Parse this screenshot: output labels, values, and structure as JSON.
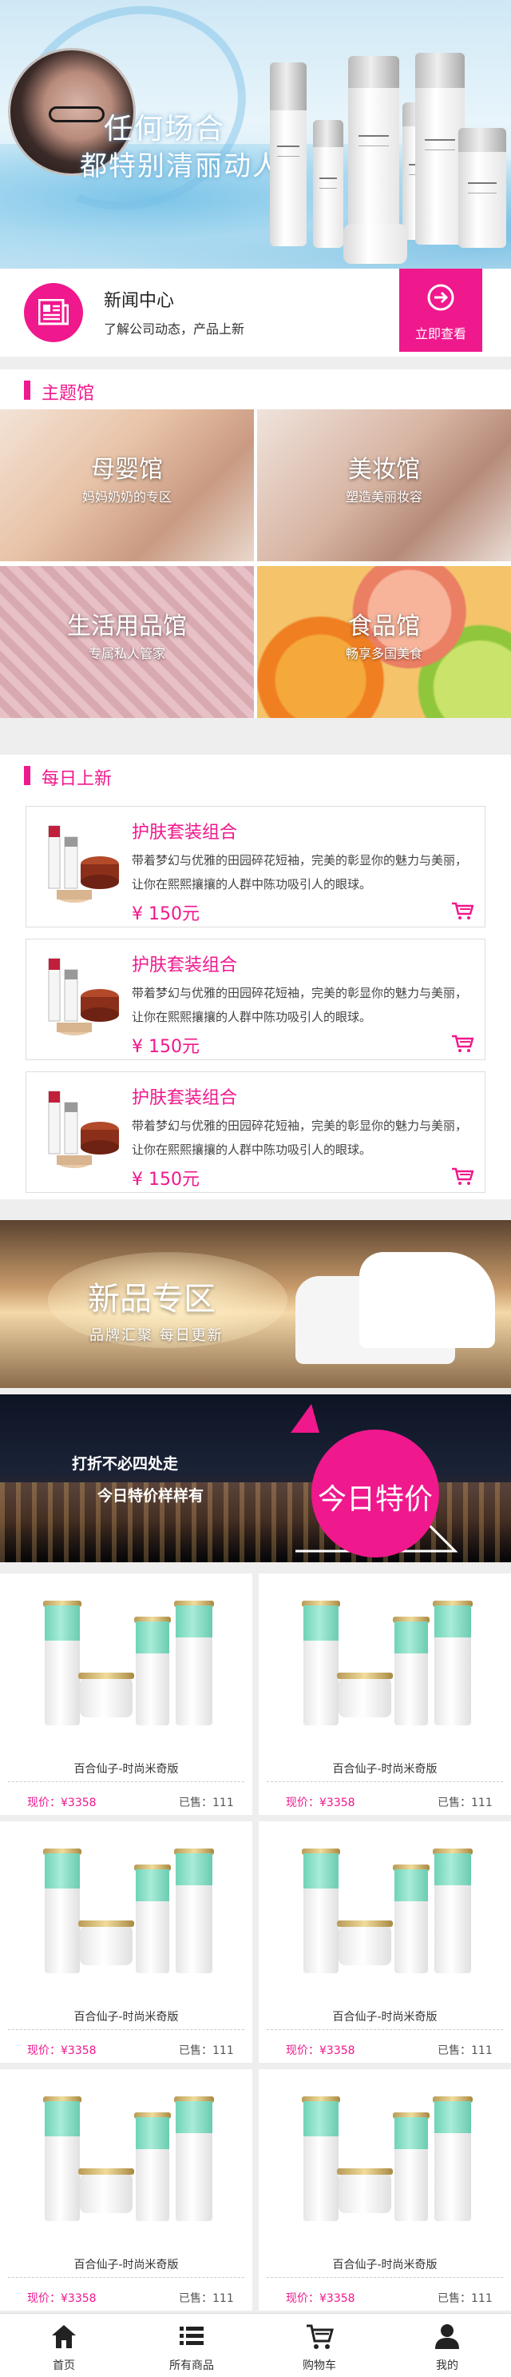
{
  "hero": {
    "slogan_line1": "任何场合",
    "slogan_line2": "都特别清丽动人"
  },
  "news": {
    "icon": "newspaper-icon",
    "title": "新闻中心",
    "subtitle": "了解公司动态，产品上新",
    "button_label": "立即查看",
    "button_icon": "arrow-right-circle-icon"
  },
  "theme_section": {
    "title": "主题馆",
    "tiles": [
      {
        "name": "母婴馆",
        "desc": "妈妈奶奶的专区"
      },
      {
        "name": "美妆馆",
        "desc": "塑造美丽妆容"
      },
      {
        "name": "生活用品馆",
        "desc": "专属私人管家"
      },
      {
        "name": "食品馆",
        "desc": "畅享多国美食"
      }
    ]
  },
  "daily_section": {
    "title": "每日上新",
    "items": [
      {
        "title": "护肤套装组合",
        "desc": "带着梦幻与优雅的田园碎花短袖，完美的彰显你的魅力与美丽，让你在熙熙攘攘的人群中陈功吸引人的眼球。",
        "price": "¥ 150元"
      },
      {
        "title": "护肤套装组合",
        "desc": "带着梦幻与优雅的田园碎花短袖，完美的彰显你的魅力与美丽，让你在熙熙攘攘的人群中陈功吸引人的眼球。",
        "price": "¥ 150元"
      },
      {
        "title": "护肤套装组合",
        "desc": "带着梦幻与优雅的田园碎花短袖，完美的彰显你的魅力与美丽，让你在熙熙攘攘的人群中陈功吸引人的眼球。",
        "price": "¥ 150元"
      }
    ]
  },
  "banner_new": {
    "title": "新品专区",
    "subtitle": "品牌汇聚  每日更新"
  },
  "banner_sale": {
    "line1": "打折不必四处走",
    "line2": "今日特价样样有",
    "badge": "今日特价"
  },
  "products": [
    {
      "name": "百合仙子-时尚米奇版",
      "price": "现价：¥3358",
      "sold": "已售：111"
    },
    {
      "name": "百合仙子-时尚米奇版",
      "price": "现价：¥3358",
      "sold": "已售：111"
    },
    {
      "name": "百合仙子-时尚米奇版",
      "price": "现价：¥3358",
      "sold": "已售：111"
    },
    {
      "name": "百合仙子-时尚米奇版",
      "price": "现价：¥3358",
      "sold": "已售：111"
    },
    {
      "name": "百合仙子-时尚米奇版",
      "price": "现价：¥3358",
      "sold": "已售：111"
    },
    {
      "name": "百合仙子-时尚米奇版",
      "price": "现价：¥3358",
      "sold": "已售：111"
    }
  ],
  "tabbar": [
    {
      "label": "首页",
      "icon": "home-icon"
    },
    {
      "label": "所有商品",
      "icon": "list-icon"
    },
    {
      "label": "购物车",
      "icon": "cart-icon"
    },
    {
      "label": "我的",
      "icon": "user-icon"
    }
  ],
  "colors": {
    "accent": "#f0188d"
  }
}
